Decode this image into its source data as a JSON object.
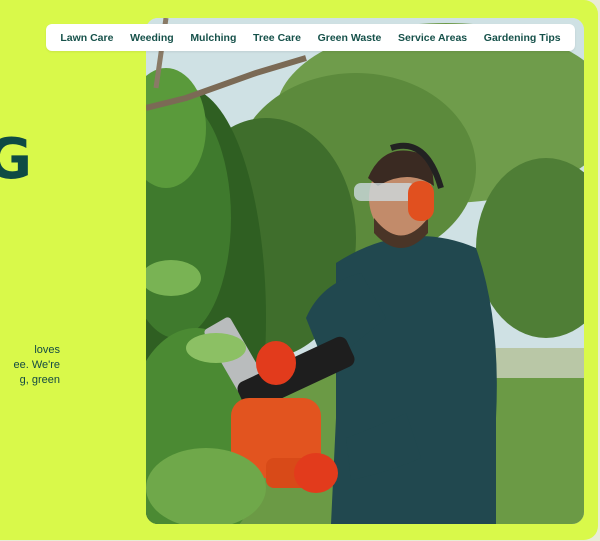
{
  "nav": {
    "items": [
      {
        "label": "Lawn Care"
      },
      {
        "label": "Weeding"
      },
      {
        "label": "Mulching"
      },
      {
        "label": "Tree Care"
      },
      {
        "label": "Green Waste"
      },
      {
        "label": "Service Areas"
      },
      {
        "label": "Gardening Tips"
      }
    ]
  },
  "hero": {
    "heading_fragment": "G",
    "copy_lines": [
      "loves",
      "ee. We're",
      "g, green"
    ]
  },
  "colors": {
    "background": "#d9f94a",
    "accent_dark": "#0e4b44"
  }
}
